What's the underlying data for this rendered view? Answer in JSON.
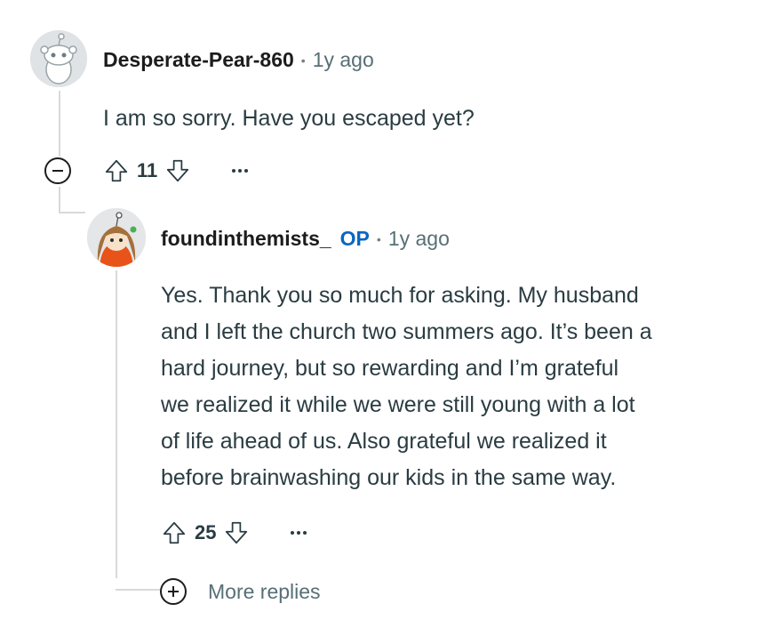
{
  "comments": [
    {
      "username": "Desperate-Pear-860",
      "separator": "•",
      "age": "1y ago",
      "body": "I am so sorry. Have you escaped yet?",
      "score": "11",
      "avatar_icon": "snoo-avatar-icon"
    },
    {
      "username": "foundinthemists_",
      "op_badge": "OP",
      "separator": "•",
      "age": "1y ago",
      "body_lines": [
        "Yes. Thank you so much for asking. My husband",
        "and I left the church two summers ago. It’s been a",
        "hard journey, but so rewarding and I’m grateful",
        "we realized it while we were still young with a lot",
        "of life ahead of us. Also grateful we realized it",
        "before brainwashing our kids in the same way."
      ],
      "score": "25",
      "avatar_icon": "snoo-avatar-icon"
    }
  ],
  "more_replies": "More replies",
  "colors": {
    "op": "#0a66c2",
    "meta": "#576f76",
    "text": "#2a3c42",
    "thread_line": "#d7dadc"
  }
}
